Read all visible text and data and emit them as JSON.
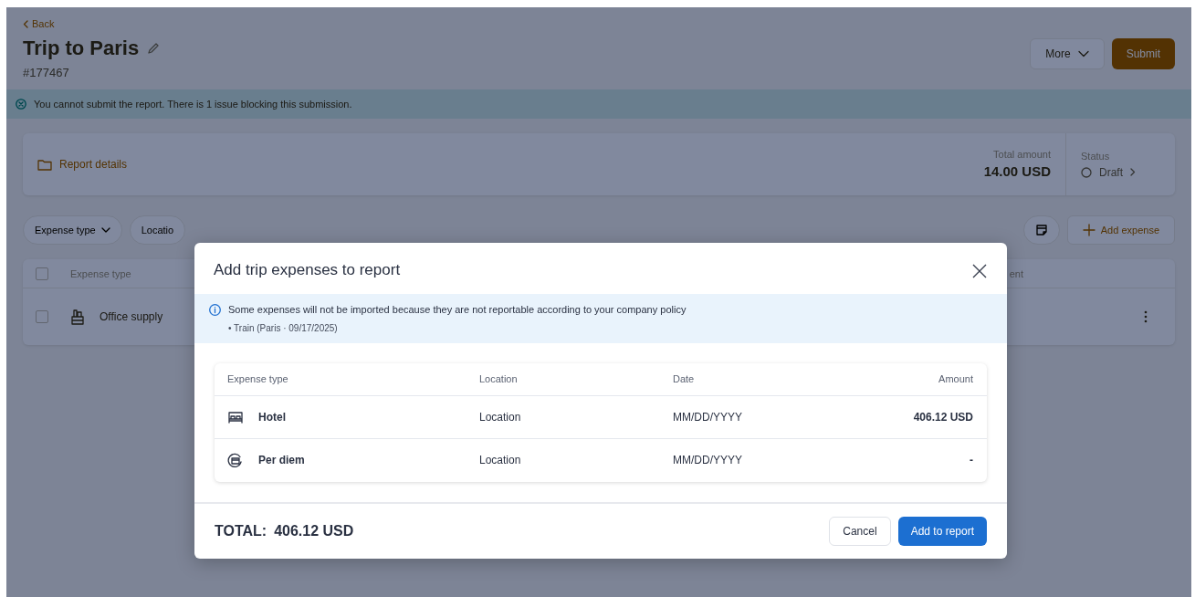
{
  "page": {
    "back": "Back",
    "title": "Trip to Paris",
    "report_id": "#177467",
    "actions": [
      {
        "label": "More",
        "kind": "dropdown"
      },
      {
        "label": "Submit",
        "kind": "primary"
      }
    ]
  },
  "error_banner": "You cannot submit the report. There is 1 issue blocking this submission.",
  "report_summary": {
    "link": "Report details",
    "total_label": "Total amount",
    "total": "14.00 USD",
    "status_label": "Status",
    "status": "Draft"
  },
  "filters": [
    {
      "label": "Expense type",
      "kind": "dropdown"
    },
    {
      "label": "Locatio",
      "kind": "plain"
    }
  ],
  "toolbar": {
    "add_button": "Add expense"
  },
  "expenses_table": {
    "header_checked": false,
    "columns": [
      "Expense type",
      "ent"
    ],
    "rows": [
      {
        "type": "Office supply",
        "checked": false
      }
    ]
  },
  "modal": {
    "title": "Add trip expenses to report",
    "notice": {
      "message": "Some expenses will not be imported because they are not reportable according to your company policy",
      "items": [
        "• Train (Paris · 09/17/2025)"
      ]
    },
    "columns": [
      "Expense type",
      "Location",
      "Date",
      "Amount"
    ],
    "rows": [
      {
        "kind": "hotel",
        "type": "Hotel",
        "location": "Location",
        "date": "MM/DD/YYYY",
        "amount": "406.12 USD"
      },
      {
        "kind": "per_diem",
        "type": "Per diem",
        "location": "Location",
        "date": "MM/DD/YYYY",
        "amount": "-"
      }
    ],
    "total_label": "TOTAL:",
    "total": "406.12 USD",
    "buttons": [
      {
        "label": "Cancel",
        "kind": "secondary"
      },
      {
        "label": "Add to report",
        "kind": "primary"
      }
    ]
  }
}
